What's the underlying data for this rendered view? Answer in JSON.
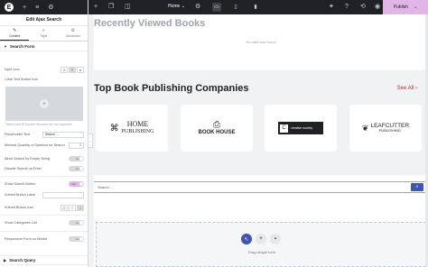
{
  "panel": {
    "logo_letter": "E",
    "title": "Edit Ajax Search",
    "tabs": [
      {
        "label": "Content",
        "icon": "pencil-icon"
      },
      {
        "label": "Style",
        "icon": "half-circle-icon"
      },
      {
        "label": "Advanced",
        "icon": "gear-icon"
      }
    ],
    "section_form": "Search Form",
    "input_icon": "Input Icon",
    "clear_icon": "Clear Text Button Icon",
    "note": "Flatiron and fill Explorer Browsers are not supported",
    "placeholder_label": "Placeholder Text",
    "placeholder_value": "Search ...",
    "min_symbols_label": "Minimal Quantity of Symbols for Search",
    "min_symbols_value": "2",
    "allow_empty_label": "Allow Search by Empty String",
    "disable_enter_label": "Disable Submit on Enter",
    "show_submit_label": "Show Submit Button",
    "submit_label_label": "Submit Button Label",
    "submit_icon_label": "Submit Button Icon",
    "show_categories_label": "Show Categories List",
    "responsive_label": "Responsive Form on Mobile",
    "toggle_no": "No",
    "toggle_yes": "Yes",
    "section_query": "Search Query"
  },
  "topbar": {
    "page": "Home",
    "publish": "Publish"
  },
  "canvas": {
    "recent_title": "Recently Viewed Books",
    "no_data": "No data was found",
    "pub_title": "Top Book Publishing Companies",
    "see_all": "See All",
    "publishers": [
      {
        "line1": "HOME",
        "line2": "PUBLISHING"
      },
      {
        "line1": "BOOK HOUSE",
        "line2": ""
      },
      {
        "line1": "creative society",
        "line2": ""
      },
      {
        "line1": "LEAFCUTTER",
        "line2": "PUBLISHING"
      }
    ],
    "search_placeholder": "Search ...",
    "drag_text": "Drag widget here"
  },
  "colors": {
    "accent": "#e2b5e9",
    "search_button": "#4054b2",
    "see_all": "#b4302c"
  }
}
